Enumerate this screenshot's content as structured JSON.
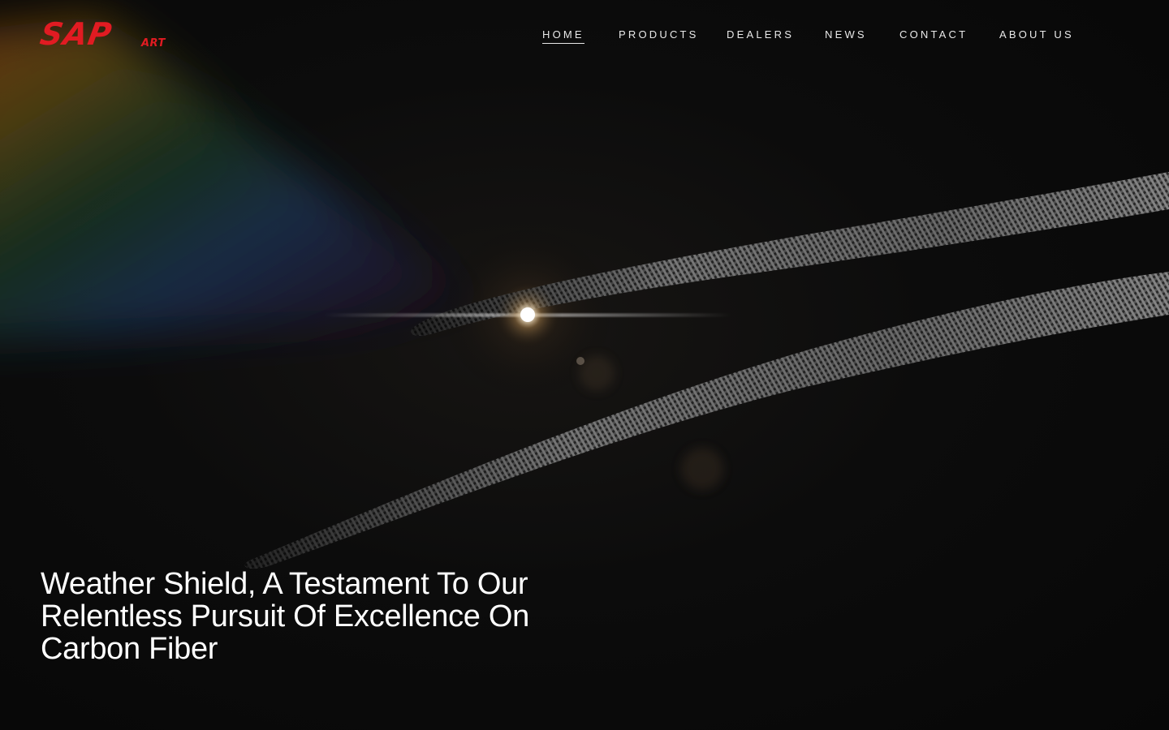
{
  "brand": {
    "logo_main": "SAP",
    "logo_sub": "ART",
    "accent_color": "#e11b22"
  },
  "nav": {
    "items": [
      {
        "label": "HOME",
        "active": true
      },
      {
        "label": "PRODUCTS",
        "active": false
      },
      {
        "label": "DEALERS",
        "active": false
      },
      {
        "label": "NEWS",
        "active": false
      },
      {
        "label": "CONTACT",
        "active": false
      },
      {
        "label": "ABOUT US",
        "active": false
      }
    ]
  },
  "hero": {
    "title": "Weather Shield, A Testament To Our Relentless Pursuit Of Excellence On Carbon Fiber",
    "background": "carbon-fiber-strips-with-lens-flare-and-rainbow-light"
  }
}
